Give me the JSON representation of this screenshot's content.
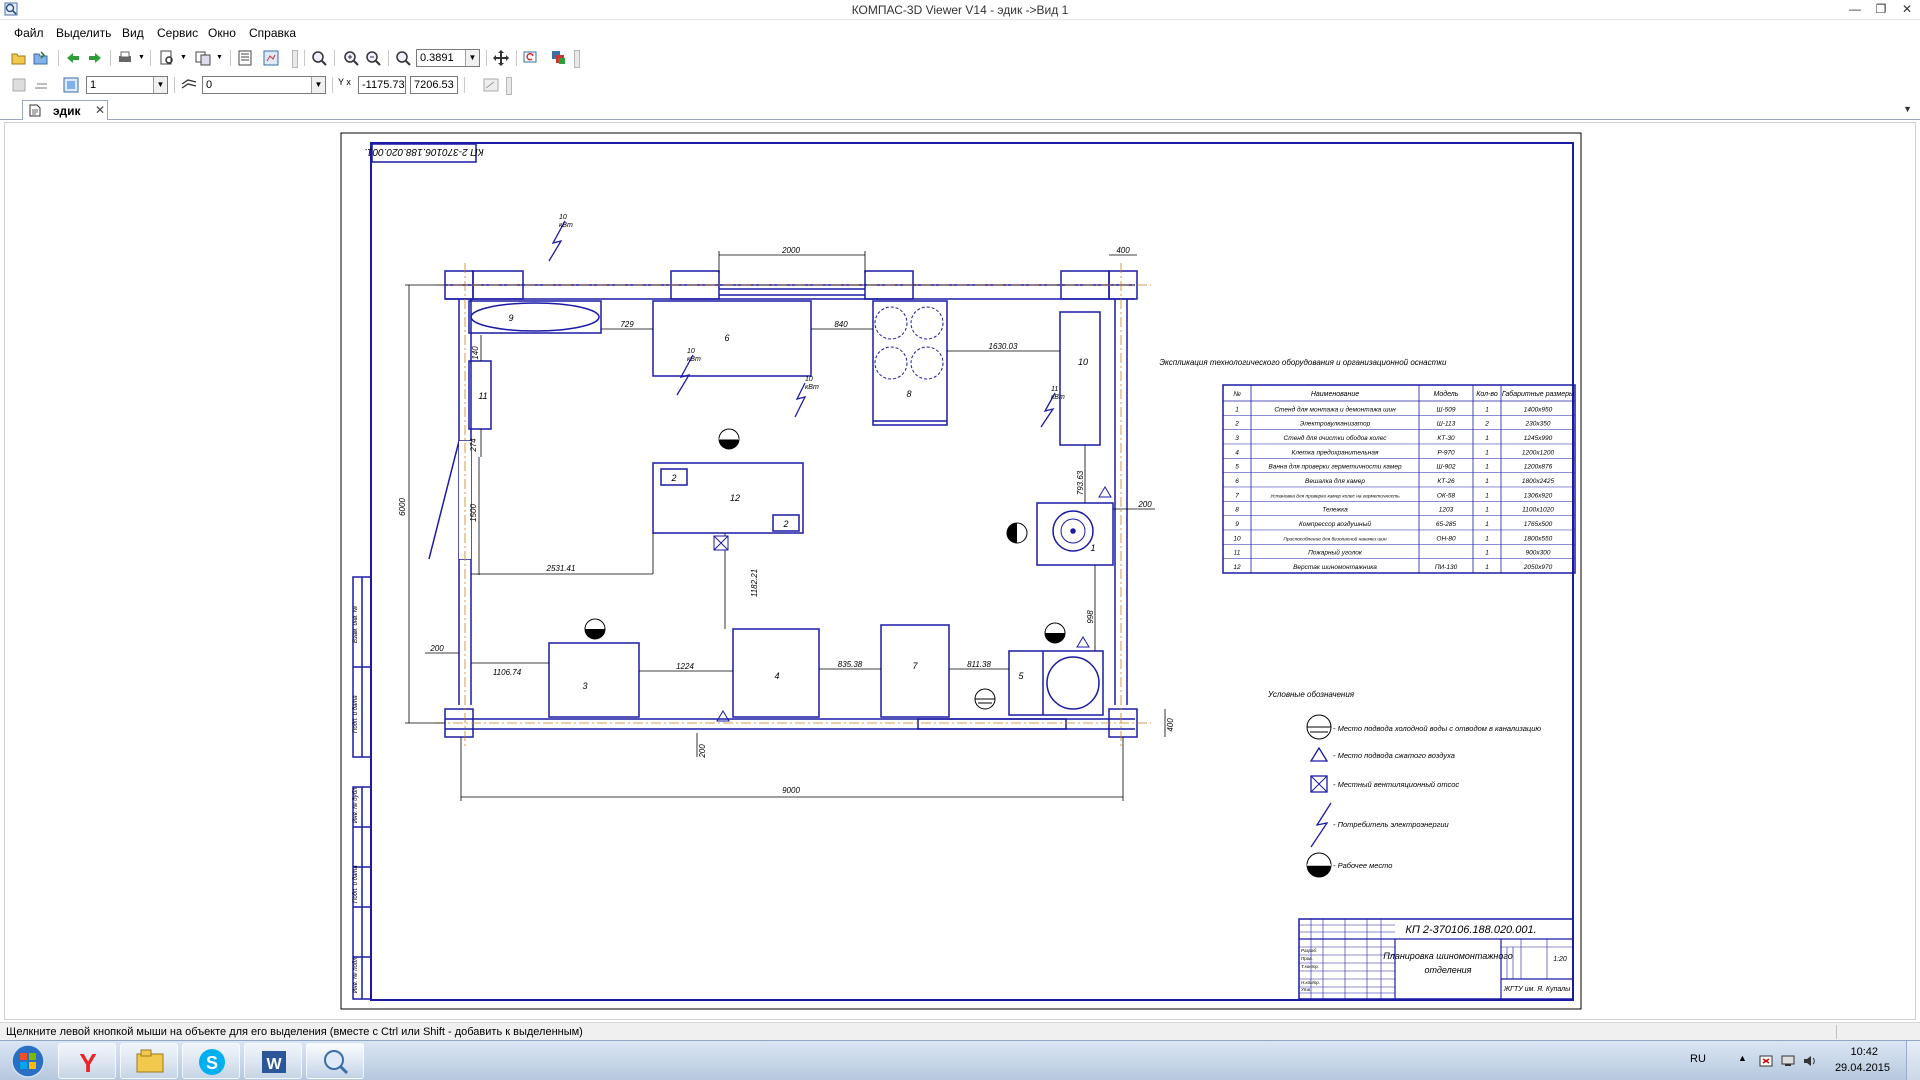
{
  "window": {
    "title": "КОМПАС-3D Viewer V14 - эдик ->Вид 1",
    "minimize": "—",
    "restore": "❐",
    "close": "✕"
  },
  "menu": [
    "Файл",
    "Выделить",
    "Вид",
    "Сервис",
    "Окно",
    "Справка"
  ],
  "toolbar1": {
    "zoom": "0.3891"
  },
  "toolbar2": {
    "layer": "1",
    "style": "0",
    "coord_x": "-1175.73",
    "coord_y": "7206.53",
    "coord_label": "Y x"
  },
  "tab": {
    "label": "эдик",
    "close": "✕"
  },
  "status": {
    "message": "Щелкните левой кнопкой мыши на объекте для его выделения (вместе с Ctrl или Shift - добавить к выделенным)"
  },
  "drawing": {
    "stamp_top": "КП 2-370106.188.020.001.",
    "dimensions": [
      "2000",
      "400",
      "729",
      "840",
      "1630.03",
      "140",
      "274",
      "1500",
      "6000",
      "2531.41",
      "1182.21",
      "2531.41",
      "200",
      "1106.74",
      "1224",
      "835.38",
      "811.38",
      "793.63",
      "998",
      "200",
      "400",
      "200",
      "9000"
    ],
    "equipment_labels": [
      "1",
      "2",
      "3",
      "4",
      "5",
      "6",
      "7",
      "8",
      "9",
      "10",
      "11",
      "12"
    ],
    "power_labels": [
      {
        "num": "10",
        "unit": "кВт"
      },
      {
        "num": "10",
        "unit": "кВт"
      },
      {
        "num": "10",
        "unit": "кВт"
      },
      {
        "num": "11",
        "unit": "кВт"
      }
    ],
    "table_title": "Экспликация технологического оборудования и организационной оснастки",
    "table_headers": [
      "№",
      "Наименование",
      "Модель",
      "Кол-во",
      "Габаритные размеры"
    ],
    "table_rows": [
      [
        "1",
        "Стенд для монтажа и демонтажа шин",
        "Ш-509",
        "1",
        "1400x950"
      ],
      [
        "2",
        "Электровулканизатор",
        "Ш-113",
        "2",
        "230x350"
      ],
      [
        "3",
        "Стенд для очистки ободов колес",
        "КТ-30",
        "1",
        "1245x990"
      ],
      [
        "4",
        "Клетка предохранительная",
        "Р-970",
        "1",
        "1200x1200"
      ],
      [
        "5",
        "Ванна для проверки герметичности камер",
        "Ш-902",
        "1",
        "1200x876"
      ],
      [
        "6",
        "Вешалка для камер",
        "КТ-26",
        "1",
        "1800x2425"
      ],
      [
        "7",
        "Установка для проверки камер колес на герметичность",
        "ОК-58",
        "1",
        "1306x920"
      ],
      [
        "8",
        "Тележка",
        "1203",
        "1",
        "1100x1020"
      ],
      [
        "9",
        "Компрессор воздушный",
        "65-285",
        "1",
        "1765x500"
      ],
      [
        "10",
        "Приспособление для безопасной накачки шин",
        "ОН-80",
        "1",
        "1800x550"
      ],
      [
        "11",
        "Пожарный уголок",
        "",
        "1",
        "900x300"
      ],
      [
        "12",
        "Верстак шиномонтажника",
        "ПИ-130",
        "1",
        "2050x970"
      ]
    ],
    "legend_title": "Условные обозначения",
    "legend": [
      {
        "icon": "water-supply-icon",
        "text": "- Место подвода холодной воды с отводом в канализацию"
      },
      {
        "icon": "compressed-air-icon",
        "text": "- Место подвода сжатого воздуха"
      },
      {
        "icon": "ventilation-icon",
        "text": "- Местный вентиляционный отсос"
      },
      {
        "icon": "power-consumer-icon",
        "text": "- Потребитель электроэнергии"
      },
      {
        "icon": "workplace-icon",
        "text": "- Рабочее место"
      }
    ],
    "title_block": {
      "code": "КП 2-370106.188.020.001.",
      "name_line1": "Планировка шиномонтажного",
      "name_line2": "отделения",
      "scale": "1:20",
      "org": "ЖГТУ им. Я. Купалы",
      "roles": [
        "Разраб.",
        "Пров.",
        "Т.контр.",
        "Н.контр.",
        "Утв."
      ]
    },
    "side_stamp": [
      "Взам. инв. №",
      "Подп. и дата",
      "Инв. № дубл.",
      "Подп. и дата",
      "Инв. № подл."
    ]
  },
  "taskbar": {
    "lang": "RU",
    "time": "10:42",
    "date": "29.04.2015",
    "apps": [
      "yandex-browser",
      "file-explorer",
      "skype",
      "word",
      "kompas-viewer"
    ]
  }
}
